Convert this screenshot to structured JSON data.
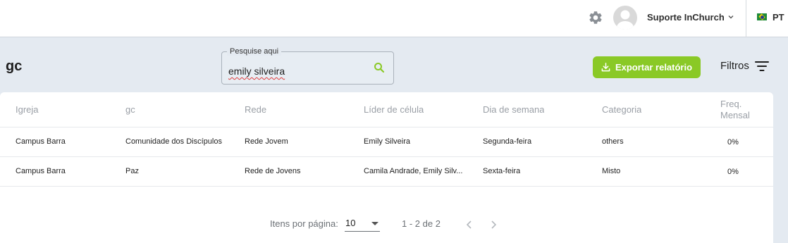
{
  "topbar": {
    "settings_icon": "gear-icon",
    "avatar_icon": "user-avatar-icon",
    "user_name": "Suporte InChurch",
    "user_menu_icon": "chevron-down-icon",
    "language_flag": "brazil-flag-icon",
    "language": "PT"
  },
  "page": {
    "title": "gc"
  },
  "search": {
    "label": "Pesquise aqui",
    "value": "emily silveira",
    "icon": "search-icon"
  },
  "actions": {
    "export_label": "Exportar relatório",
    "export_icon": "download-icon",
    "filters_label": "Filtros",
    "filters_icon": "filter-icon"
  },
  "table": {
    "columns": [
      "Igreja",
      "gc",
      "Rede",
      "Líder de célula",
      "Dia de semana",
      "Categoria",
      "Freq.",
      "Mensal"
    ],
    "rows": [
      [
        "Campus Barra",
        "Comunidade dos Discípulos",
        "Rede Jovem",
        "Emily Silveira",
        "Segunda-feira",
        "others",
        "0%"
      ],
      [
        "Campus Barra",
        "Paz",
        "Rede de Jovens",
        "Camila Andrade, Emily Silv...",
        "Sexta-feira",
        "Misto",
        "0%"
      ]
    ]
  },
  "pagination": {
    "items_per_page_label": "Itens por página:",
    "items_per_page": "10",
    "range": "1 - 2 de 2"
  },
  "colors": {
    "accent_green": "#8ac926",
    "background": "#e4eaf1",
    "header_text": "#9a9fa6"
  }
}
